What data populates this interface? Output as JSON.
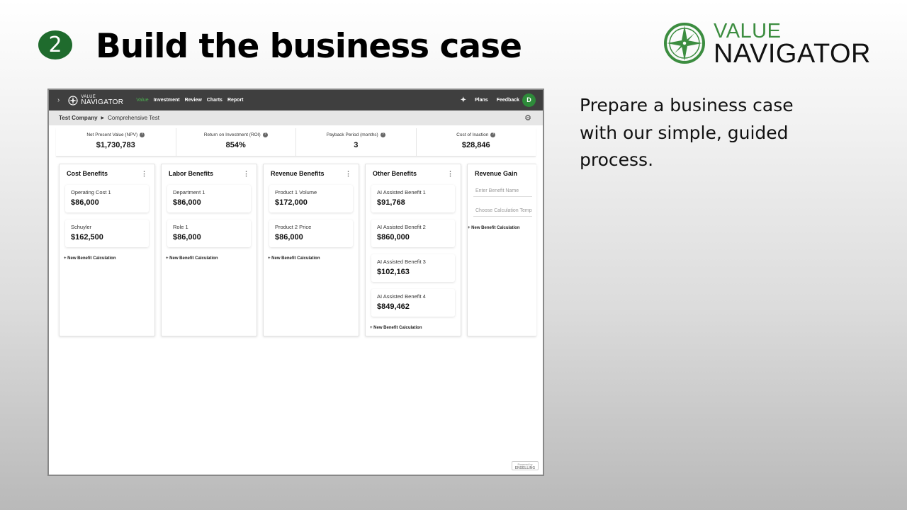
{
  "slide": {
    "step_number": "2",
    "title": "Build the business case",
    "description": "Prepare a business case with our simple, guided process."
  },
  "brand": {
    "line1": "VALUE",
    "line2": "NAVIGATOR",
    "accent_color": "#3c8d40"
  },
  "app": {
    "logo_line1": "VALUE",
    "logo_line2": "NAVIGATOR",
    "nav": [
      "Value",
      "Investment",
      "Review",
      "Charts",
      "Report"
    ],
    "active_nav": "Value",
    "plans_label": "Plans",
    "feedback_label": "Feedback",
    "avatar_initial": "D",
    "breadcrumb": {
      "company": "Test Company",
      "project": "Comprehensive Test"
    },
    "metrics": [
      {
        "label": "Net Present Value (NPV)",
        "value": "$1,730,783"
      },
      {
        "label": "Return on Investment (ROI)",
        "value": "854%"
      },
      {
        "label": "Payback Period (months)",
        "value": "3"
      },
      {
        "label": "Cost of Inaction",
        "value": "$28,846"
      }
    ],
    "columns": [
      {
        "title": "Cost Benefits",
        "cards": [
          {
            "name": "Operating Cost 1",
            "value": "$86,000"
          },
          {
            "name": "Schuyler",
            "value": "$162,500"
          }
        ]
      },
      {
        "title": "Labor Benefits",
        "cards": [
          {
            "name": "Department 1",
            "value": "$86,000"
          },
          {
            "name": "Role 1",
            "value": "$86,000"
          }
        ]
      },
      {
        "title": "Revenue Benefits",
        "cards": [
          {
            "name": "Product 1 Volume",
            "value": "$172,000"
          },
          {
            "name": "Product 2 Price",
            "value": "$86,000"
          }
        ]
      },
      {
        "title": "Other Benefits",
        "cards": [
          {
            "name": "AI Assisted Benefit 1",
            "value": "$91,768"
          },
          {
            "name": "AI Assisted Benefit 2",
            "value": "$860,000"
          },
          {
            "name": "AI Assisted Benefit 3",
            "value": "$102,163"
          },
          {
            "name": "AI Assisted Benefit 4",
            "value": "$849,462"
          }
        ]
      }
    ],
    "add_benefit_label": "+ New Benefit Calculation",
    "new_column": {
      "title": "Revenue Gain",
      "name_placeholder": "Enter Benefit Name",
      "template_placeholder": "Choose Calculation Templ"
    },
    "watermark": {
      "line1": "Powered by",
      "line2": "ENSELLING"
    }
  }
}
